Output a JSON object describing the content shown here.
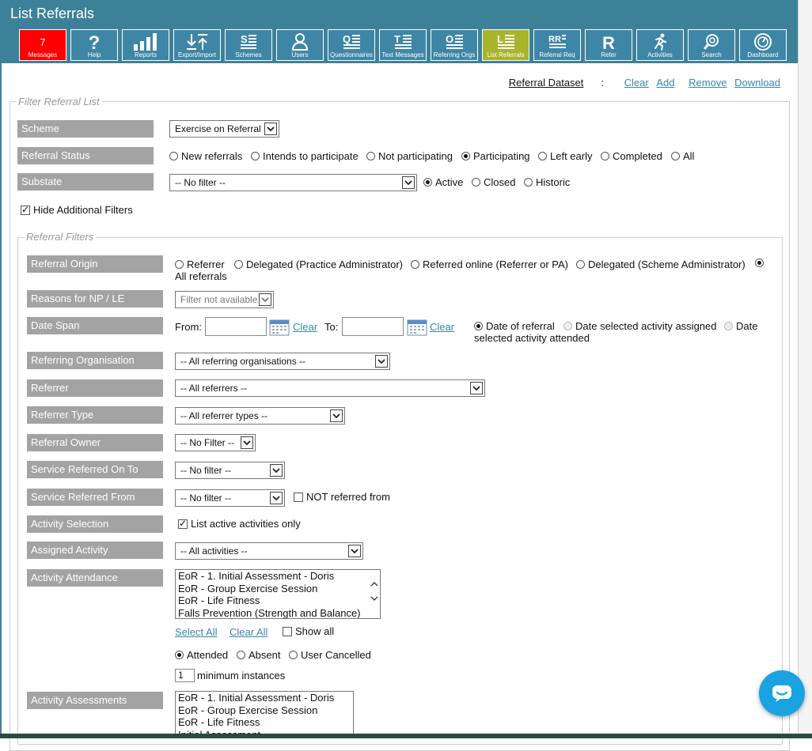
{
  "header": {
    "title": "List Referrals"
  },
  "nav": {
    "messages_count": "7",
    "items": [
      {
        "label": "Messages",
        "icon": "envelope-icon"
      },
      {
        "label": "Help",
        "icon": "question-icon"
      },
      {
        "label": "Reports",
        "icon": "bar-chart-icon"
      },
      {
        "label": "Export/Import",
        "icon": "export-import-icon"
      },
      {
        "label": "Schemes",
        "icon": "schemes-icon"
      },
      {
        "label": "Users",
        "icon": "user-icon"
      },
      {
        "label": "Questionnaires",
        "icon": "questionnaire-icon"
      },
      {
        "label": "Text Messages",
        "icon": "text-message-icon"
      },
      {
        "label": "Referring Orgs",
        "icon": "referring-orgs-icon"
      },
      {
        "label": "List Referrals",
        "icon": "list-referrals-icon"
      },
      {
        "label": "Referral Req",
        "icon": "referral-request-icon"
      },
      {
        "label": "Refer",
        "icon": "refer-icon"
      },
      {
        "label": "Activities",
        "icon": "running-person-icon"
      },
      {
        "label": "Search",
        "icon": "search-icon"
      },
      {
        "label": "Dashboard",
        "icon": "dashboard-icon"
      }
    ],
    "active_color": "#a9b42b",
    "messages_color": "#ff0000"
  },
  "dataset": {
    "label": "Referral Dataset",
    "clear": "Clear",
    "add": "Add",
    "remove": "Remove",
    "download": "Download"
  },
  "filter": {
    "legend": "Filter Referral List",
    "scheme": {
      "label": "Scheme",
      "value": "Exercise on Referral"
    },
    "status": {
      "label": "Referral Status",
      "options": [
        "New referrals",
        "Intends to participate",
        "Not participating",
        "Participating",
        "Left early",
        "Completed",
        "All"
      ],
      "selected": "Participating"
    },
    "substate": {
      "label": "Substate",
      "value": "-- No filter --",
      "options": [
        "Active",
        "Closed",
        "Historic"
      ],
      "selected": "Active"
    },
    "hide_additional": "Hide Additional Filters"
  },
  "referral_filters": {
    "legend": "Referral Filters",
    "origin": {
      "label": "Referral Origin",
      "options": [
        "Referrer",
        "Delegated (Practice Administrator)",
        "Referred online (Referrer or PA)",
        "Delegated (Scheme Administrator)",
        "All referrals"
      ],
      "selected": "All referrals"
    },
    "reasons": {
      "label": "Reasons for NP / LE",
      "value": "Filter not available"
    },
    "date_span": {
      "label": "Date Span",
      "from": "From:",
      "to": "To:",
      "clear": "Clear",
      "options": [
        "Date of referral",
        "Date selected activity assigned",
        "Date",
        "selected activity attended"
      ],
      "selected": "Date of referral"
    },
    "org": {
      "label": "Referring Organisation",
      "value": "-- All referring organisations --"
    },
    "referrer": {
      "label": "Referrer",
      "value": "-- All referrers --"
    },
    "referrer_type": {
      "label": "Referrer Type",
      "value": "-- All referrer types --"
    },
    "owner": {
      "label": "Referral Owner",
      "value": "-- No Filter --"
    },
    "service_to": {
      "label": "Service Referred On To",
      "value": "-- No filter --"
    },
    "service_from": {
      "label": "Service Referred From",
      "value": "-- No filter --",
      "not_from": "NOT referred from"
    },
    "activity_selection": {
      "label": "Activity Selection",
      "check": "List active activities only"
    },
    "assigned": {
      "label": "Assigned Activity",
      "value": "-- All activities --"
    },
    "attendance": {
      "label": "Activity Attendance",
      "items": [
        "EoR - 1. Initial Assessment - Doris",
        "EoR - Group Exercise Session",
        "EoR - Life Fitness",
        "Falls Prevention (Strength and Balance)"
      ],
      "select_all": "Select All",
      "clear_all": "Clear All",
      "show_all": "Show all",
      "options": [
        "Attended",
        "Absent",
        "User Cancelled"
      ],
      "selected": "Attended",
      "min_value": "1",
      "min_label": "minimum instances"
    },
    "assessments": {
      "label": "Activity Assessments",
      "items": [
        "EoR - 1. Initial Assessment - Doris",
        "EoR - Group Exercise Session",
        "EoR - Life Fitness",
        "Initial Assessment"
      ]
    }
  },
  "colors": {
    "header": "#3d8198",
    "label_bg": "#a3a3a3",
    "link": "#3a86a8",
    "chat": "#1aa3e0"
  }
}
